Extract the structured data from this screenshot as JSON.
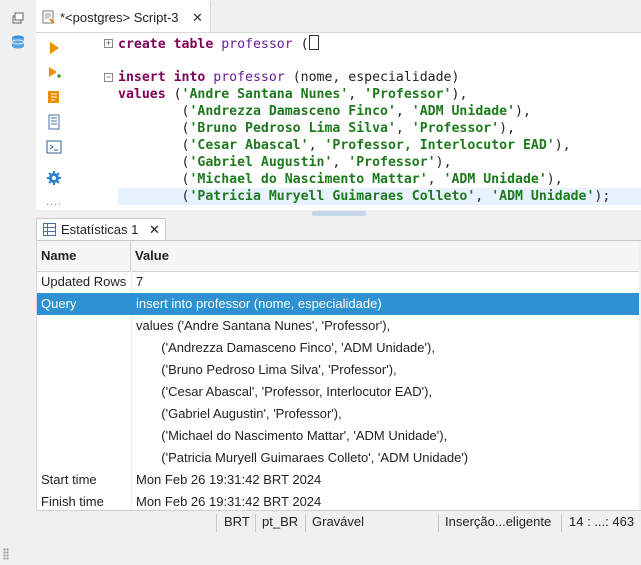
{
  "editor_tab": {
    "title": "*<postgres> Script-3",
    "close": "✕"
  },
  "code": {
    "line1": {
      "kw1": "create table",
      "id": "professor",
      "rest": " ("
    },
    "line3": {
      "kw": "insert into",
      "id": "professor",
      "rest": " (nome, especialidade)"
    },
    "line4": {
      "kw": "values",
      "lp": " (",
      "s1": "'Andre Santana Nunes'",
      "c": ", ",
      "s2": "'Professor'",
      "end": "),"
    },
    "line5": {
      "lp": "        (",
      "s1": "'Andrezza Damasceno Finco'",
      "c": ", ",
      "s2": "'ADM Unidade'",
      "end": "),"
    },
    "line6": {
      "lp": "        (",
      "s1": "'Bruno Pedroso Lima Silva'",
      "c": ", ",
      "s2": "'Professor'",
      "end": "),"
    },
    "line7": {
      "lp": "        (",
      "s1": "'Cesar Abascal'",
      "c": ", ",
      "s2": "'Professor, Interlocutor EAD'",
      "end": "),"
    },
    "line8": {
      "lp": "        (",
      "s1": "'Gabriel Augustin'",
      "c": ", ",
      "s2": "'Professor'",
      "end": "),"
    },
    "line9": {
      "lp": "        (",
      "s1": "'Michael do Nascimento Mattar'",
      "c": ", ",
      "s2": "'ADM Unidade'",
      "end": "),"
    },
    "line10": {
      "lp": "        (",
      "s1": "'Patricia Muryell Guimaraes Colleto'",
      "c": ", ",
      "s2": "'ADM Unidade'",
      "end": ");"
    }
  },
  "results_tab": {
    "title": "Estatísticas 1",
    "close": "✕"
  },
  "table": {
    "headers": {
      "name": "Name",
      "value": "Value"
    },
    "rows": [
      {
        "name": "Updated Rows",
        "value": "7"
      },
      {
        "name": "Query",
        "value": "insert into professor (nome, especialidade)"
      },
      {
        "name": "",
        "value": "values ('Andre Santana Nunes', 'Professor'),"
      },
      {
        "name": "",
        "value": "       ('Andrezza Damasceno Finco', 'ADM Unidade'),"
      },
      {
        "name": "",
        "value": "       ('Bruno Pedroso Lima Silva', 'Professor'),"
      },
      {
        "name": "",
        "value": "       ('Cesar Abascal', 'Professor, Interlocutor EAD'),"
      },
      {
        "name": "",
        "value": "       ('Gabriel Augustin', 'Professor'),"
      },
      {
        "name": "",
        "value": "       ('Michael do Nascimento Mattar', 'ADM Unidade'),"
      },
      {
        "name": "",
        "value": "       ('Patricia Muryell Guimaraes Colleto', 'ADM Unidade')"
      },
      {
        "name": "Start time",
        "value": "Mon Feb 26 19:31:42 BRT 2024"
      },
      {
        "name": "Finish time",
        "value": "Mon Feb 26 19:31:42 BRT 2024"
      }
    ]
  },
  "status": {
    "timezone": "BRT",
    "locale": "pt_BR",
    "mode": "Gravável",
    "insert": "Inserção...eligente",
    "position": "14 : ...: 463"
  },
  "colors": {
    "keyword": "#7f0055",
    "identifier": "#6a1b9a",
    "string": "#1d7a1d",
    "selection": "#2d91d2",
    "current_line": "#e8f2fe"
  }
}
